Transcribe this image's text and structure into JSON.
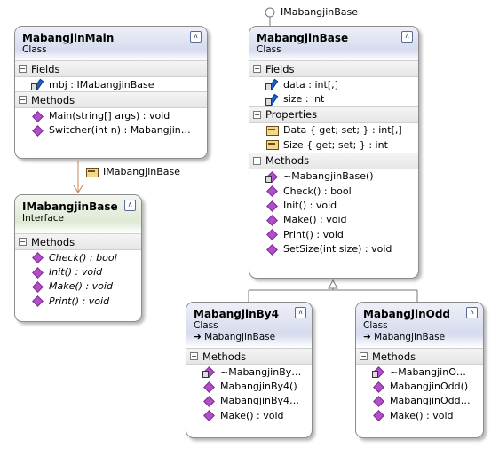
{
  "colors": {
    "class_header": "#d6dbee",
    "interface_header": "#dfe9d6",
    "border": "#8c8c8c",
    "method_icon": "#b04fc8",
    "field_icon": "#1a62c8"
  },
  "lollipop": {
    "label": "IMabangjinBase"
  },
  "association": {
    "label": "IMabangjinBase"
  },
  "main": {
    "title": "MabangjinMain",
    "stereotype": "Class",
    "fields_label": "Fields",
    "fields": [
      {
        "text": "mbj : IMabangjinBase"
      }
    ],
    "methods_label": "Methods",
    "methods": [
      {
        "text": "Main(string[] args) : void"
      },
      {
        "text": "Switcher(int n) : Mabangjin…"
      }
    ]
  },
  "iface": {
    "title": "IMabangjinBase",
    "stereotype": "Interface",
    "methods_label": "Methods",
    "methods": [
      {
        "text": "Check() : bool"
      },
      {
        "text": "Init() : void"
      },
      {
        "text": "Make() : void"
      },
      {
        "text": "Print() : void"
      }
    ]
  },
  "base": {
    "title": "MabangjinBase",
    "stereotype": "Class",
    "fields_label": "Fields",
    "fields": [
      {
        "text": "data : int[,]"
      },
      {
        "text": "size : int"
      }
    ],
    "properties_label": "Properties",
    "properties": [
      {
        "text": "Data { get; set; } : int[,]"
      },
      {
        "text": "Size { get; set; } : int"
      }
    ],
    "methods_label": "Methods",
    "methods": [
      {
        "text": "~MabangjinBase()"
      },
      {
        "text": "Check() : bool"
      },
      {
        "text": "Init() : void"
      },
      {
        "text": "Make() : void"
      },
      {
        "text": "Print() : void"
      },
      {
        "text": "SetSize(int size) : void"
      }
    ]
  },
  "by4": {
    "title": "MabangjinBy4",
    "stereotype": "Class",
    "base_ref": "➜ MabangjinBase",
    "methods_label": "Methods",
    "methods": [
      {
        "text": "~MabangjinBy…"
      },
      {
        "text": "MabangjinBy4()"
      },
      {
        "text": "MabangjinBy4…"
      },
      {
        "text": "Make() : void"
      }
    ]
  },
  "odd": {
    "title": "MabangjinOdd",
    "stereotype": "Class",
    "base_ref": "➜ MabangjinBase",
    "methods_label": "Methods",
    "methods": [
      {
        "text": "~MabangjinO…"
      },
      {
        "text": "MabangjinOdd()"
      },
      {
        "text": "MabangjinOdd…"
      },
      {
        "text": "Make() : void"
      }
    ]
  }
}
